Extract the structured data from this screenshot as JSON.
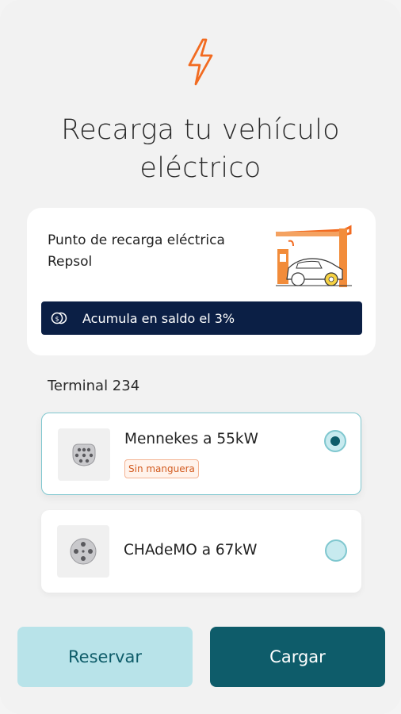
{
  "header": {
    "icon": "lightning-bolt-icon",
    "title_line1": "Recarga tu vehículo",
    "title_line2": "eléctrico"
  },
  "promo": {
    "station_name_line1": "Punto de recarga eléctrica",
    "station_name_line2": "Repsol",
    "illustration": "charging-station-illustration",
    "saldo_icon": "coin-icon",
    "saldo_text": "Acumula en saldo el 3%"
  },
  "terminal": {
    "label": "Terminal 234"
  },
  "connectors": [
    {
      "name": "Mennekes a 55kW",
      "tag": "Sin manguera",
      "icon": "mennekes-plug-icon",
      "selected": true
    },
    {
      "name": "CHAdeMO a 67kW",
      "icon": "chademo-plug-icon",
      "selected": false
    }
  ],
  "actions": {
    "reserve_label": "Reservar",
    "charge_label": "Cargar"
  },
  "colors": {
    "accent_orange": "#f26b21",
    "dark_teal": "#0e5c6a",
    "light_teal": "#b8e3e9",
    "navy": "#0b1f45"
  }
}
